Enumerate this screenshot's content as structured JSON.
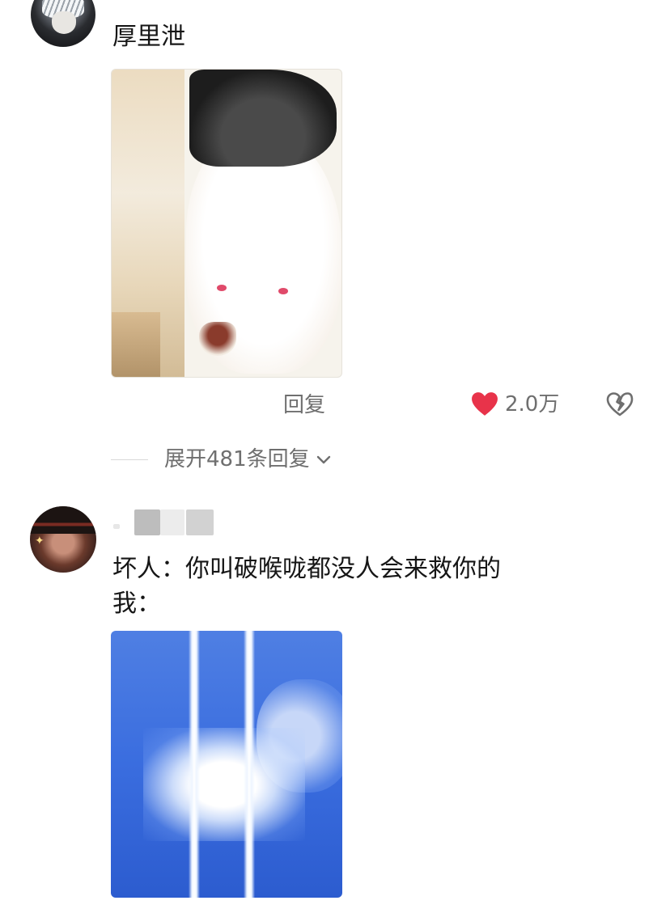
{
  "comments": [
    {
      "username": "厚里泄",
      "reply_label": "回复",
      "like_count": "2.0万",
      "expand_label": "展开481条回复",
      "colors": {
        "like": "#e8334a",
        "meta": "#6f6f6f"
      }
    },
    {
      "line1": "坏人：你叫破喉咙都没人会来救你的",
      "line2": "我："
    }
  ]
}
